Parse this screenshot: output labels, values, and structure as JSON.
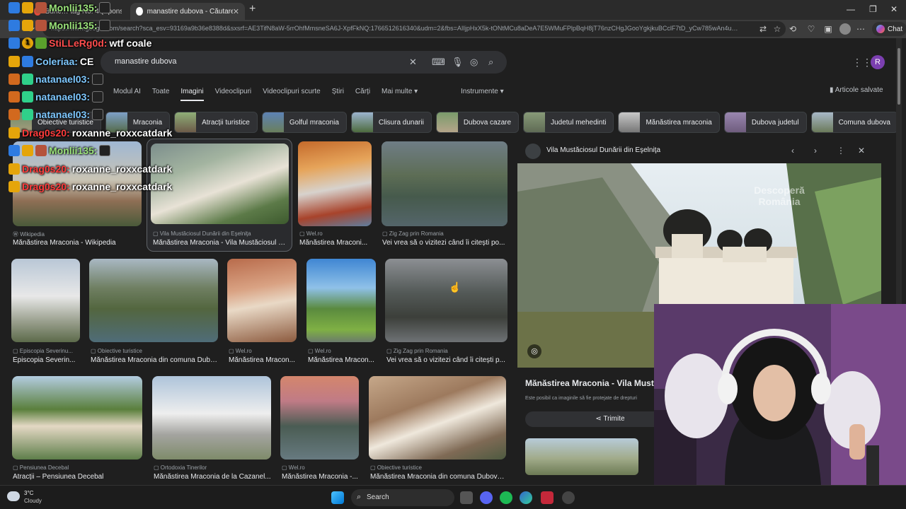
{
  "browser": {
    "tabs": [
      {
        "label": "Bunc… tag No. 4 (Sponsored)",
        "active": false
      },
      {
        "label": "manastire dubova - Căutare Goog",
        "active": true
      }
    ],
    "url": "https://www.google.com/search?sca_esv=93169a9b36e8388d&sxsrf=AE3TifN8aW-5rrOhfMmsneSA6J-XpfFkNQ:1766512616340&udm=2&fbs=AIIjpHxX5k-tONtMCu8aDeA7E5WMuFPlpBqH8jT76nzCHgJGooYgkjkuBCclF7tD_yCw785wAn4u…",
    "chat_label": "Chat"
  },
  "search": {
    "query": "manastire dubova",
    "nav": [
      "Modul AI",
      "Toate",
      "Imagini",
      "Videoclipuri",
      "Videoclipuri scurte",
      "Știri",
      "Cărți",
      "Mai multe ▾"
    ],
    "active_nav": "Imagini",
    "tools_label": "Instrumente ▾",
    "saved_label": "Articole salvate",
    "avatar_letter": "R"
  },
  "chips": [
    "Obiective turistice",
    "Mraconia",
    "Atracții turistice",
    "Golful mraconia",
    "Clisura dunarii",
    "Dubova cazare",
    "Judetul mehedinti",
    "Mănăstirea mraconia",
    "Dubova judetul",
    "Comuna dubova"
  ],
  "results": [
    {
      "source": "Wikipedia",
      "title": "Mănăstirea Mraconia - Wikipedia"
    },
    {
      "source": "Vila Mustăciosul Dunării din Eşelniţa",
      "title": "Mănăstirea Mraconia - Vila Mustăciosul D..."
    },
    {
      "source": "Wel.ro",
      "title": "Mănăstirea Mraconi..."
    },
    {
      "source": "Zig Zag prin Romania",
      "title": "Vei vrea să o vizitezi când îi citești po..."
    },
    {
      "source": "Episcopia Severinu...",
      "title": "Episcopia Severin..."
    },
    {
      "source": "Obiective turistice",
      "title": "Mănăstirea Mraconia din comuna Dubo..."
    },
    {
      "source": "Wel.ro",
      "title": "Mănăstirea Mracon..."
    },
    {
      "source": "Wel.ro",
      "title": "Mănăstirea Mracon..."
    },
    {
      "source": "Zig Zag prin Romania",
      "title": "Vei vrea să o vizitezi când îi citești p..."
    },
    {
      "source": "Pensiunea Decebal",
      "title": "Atracții – Pensiunea Decebal"
    },
    {
      "source": "Ortodoxia Tinerilor",
      "title": "Mănăstirea Mraconia de la Cazanel..."
    },
    {
      "source": "Wel.ro",
      "title": "Mănăstirea Mraconia -..."
    },
    {
      "source": "Obiective turistice",
      "title": "Mănăstirea Mraconia din comuna Dubova,..."
    }
  ],
  "panel": {
    "site": "Vila Mustăciosul Dunării din Eşelniţa",
    "title": "Mănăstirea Mraconia - Vila Mustăc",
    "note": "Este posibil ca imaginile să fie protejate de drepturi",
    "share_label": "Trimite",
    "watermark": "Descoperă România"
  },
  "chat": [
    {
      "name": "Monlii135:",
      "msg": ""
    },
    {
      "name": "Monlii135:",
      "msg": ""
    },
    {
      "name": "StiLLeRg0d:",
      "msg": "wtf coale"
    },
    {
      "name": "Coleriaa:",
      "msg": "CE"
    },
    {
      "name": "natanael03:",
      "msg": ""
    },
    {
      "name": "natanael03:",
      "msg": ""
    },
    {
      "name": "natanael03:",
      "msg": ""
    },
    {
      "name": "Drag0s20:",
      "msg": "roxanne_roxxcatdark"
    },
    {
      "name": "Monlii135:",
      "msg": ""
    },
    {
      "name": "Drag0s20:",
      "msg": "roxanne_roxxcatdark"
    },
    {
      "name": "Drag0s20:",
      "msg": "roxanne_roxxcatdark"
    }
  ],
  "chat_badge_count": "1",
  "taskbar": {
    "temp": "3°C",
    "condition": "Cloudy",
    "search_label": "Search"
  },
  "colors": {
    "accent": "#8ab4f8",
    "avatar": "#7b3fb0",
    "chat_name": "#7ec8ff"
  }
}
